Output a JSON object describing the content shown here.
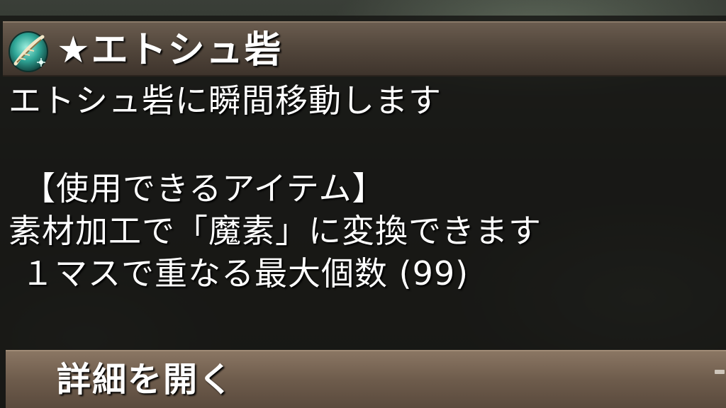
{
  "item": {
    "icon": "feather-gem-icon",
    "title": "★エトシュ砦"
  },
  "description": {
    "lines": [
      "エトシュ砦に瞬間移動します",
      "【使用できるアイテム】",
      "素材加工で「魔素」に変換できます",
      "１マスで重なる最大個数 (99)"
    ]
  },
  "footer": {
    "open_details_label": "詳細を開く"
  },
  "colors": {
    "title_bar": "#54483d",
    "footer_bar": "#6e5c4c",
    "panel": "#161614",
    "icon_accent": "#3fb8a8"
  }
}
